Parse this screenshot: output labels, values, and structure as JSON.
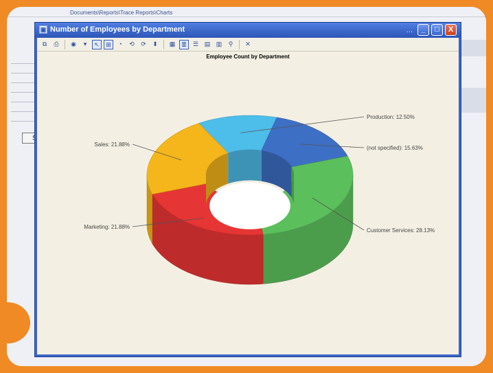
{
  "background": {
    "path": "Documents\\Reports\\Trace Reports\\Charts",
    "search_label": "Se"
  },
  "window": {
    "title": "Number of Employees by Department",
    "overflow": "...",
    "minimize": "_",
    "maximize": "□",
    "close": "X"
  },
  "toolbar": {
    "icons": [
      "copy-icon",
      "print-icon",
      "chart-type-icon",
      "dropdown-icon",
      "select-icon",
      "zoom-icon",
      "pie-icon",
      "rotate-horizontal-icon",
      "rotate-vertical-icon",
      "elevation-icon",
      "wall-icon",
      "legend-icon",
      "labels-icon",
      "grid-icon",
      "data-table-icon",
      "export-icon",
      "settings-icon"
    ]
  },
  "colors": {
    "accent": "#f08a24",
    "production": "#4dbde9",
    "not_specified": "#3d6fc4",
    "customer_services": "#5bbf5b",
    "marketing": "#e63535",
    "sales": "#f4b61a"
  },
  "chart_data": {
    "type": "pie",
    "style": "3d-doughnut",
    "title": "Employee Count by Department",
    "categories": [
      "Production",
      "(not specified)",
      "Customer Services",
      "Marketing",
      "Sales"
    ],
    "values": [
      12.5,
      15.63,
      28.13,
      21.88,
      21.88
    ],
    "labels": [
      "Production: 12.50%",
      "(not specified): 15.63%",
      "Customer Services: 28.13%",
      "Marketing: 21.88%",
      "Sales: 21.88%"
    ]
  }
}
